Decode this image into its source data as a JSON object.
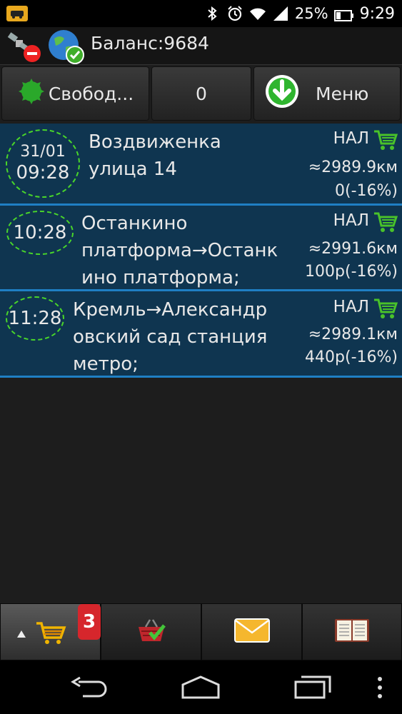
{
  "status_bar": {
    "battery_percent": "25%",
    "time": "9:29"
  },
  "header": {
    "balance": "Баланс:9684"
  },
  "actions": {
    "status_label": "Свобод...",
    "counter": "0",
    "menu_label": "Меню"
  },
  "orders": [
    {
      "date": "31/01",
      "time": "09:28",
      "address": "Воздвиженка\nулица 14",
      "payment": "НАЛ",
      "distance": "≈2989.9км",
      "price": "0(-16%)"
    },
    {
      "date": "",
      "time": "10:28",
      "address": "Останкино\nплатформа→Останк\nино платформа;",
      "payment": "НАЛ",
      "distance": "≈2991.6км",
      "price": "100р(-16%)"
    },
    {
      "date": "",
      "time": "11:28",
      "address": "Кремль→Александр\nовский сад станция\nметро;",
      "payment": "НАЛ",
      "distance": "≈2989.1км",
      "price": "440р(-16%)"
    }
  ],
  "tabs": {
    "orders_badge": "3"
  },
  "icons": {
    "status_bar": [
      "app-icon",
      "bluetooth-icon",
      "alarm-icon",
      "wifi-icon",
      "signal-icon",
      "battery-icon"
    ],
    "header": [
      "satellite-icon",
      "no-entry-icon",
      "globe-icon",
      "check-icon"
    ],
    "actions": [
      "green-gear-icon",
      "download-arrow-icon"
    ],
    "tabs": [
      "shopping-cart-icon",
      "basket-check-icon",
      "envelope-icon",
      "book-icon"
    ],
    "nav": [
      "back-icon",
      "home-icon",
      "recent-apps-icon",
      "overflow-menu-icon"
    ]
  },
  "colors": {
    "order_bg": "#0f3550",
    "order_border": "#1f7fc4",
    "time_ring": "#49d62a",
    "cart_green": "#49c22a",
    "badge_red": "#d6262c"
  }
}
